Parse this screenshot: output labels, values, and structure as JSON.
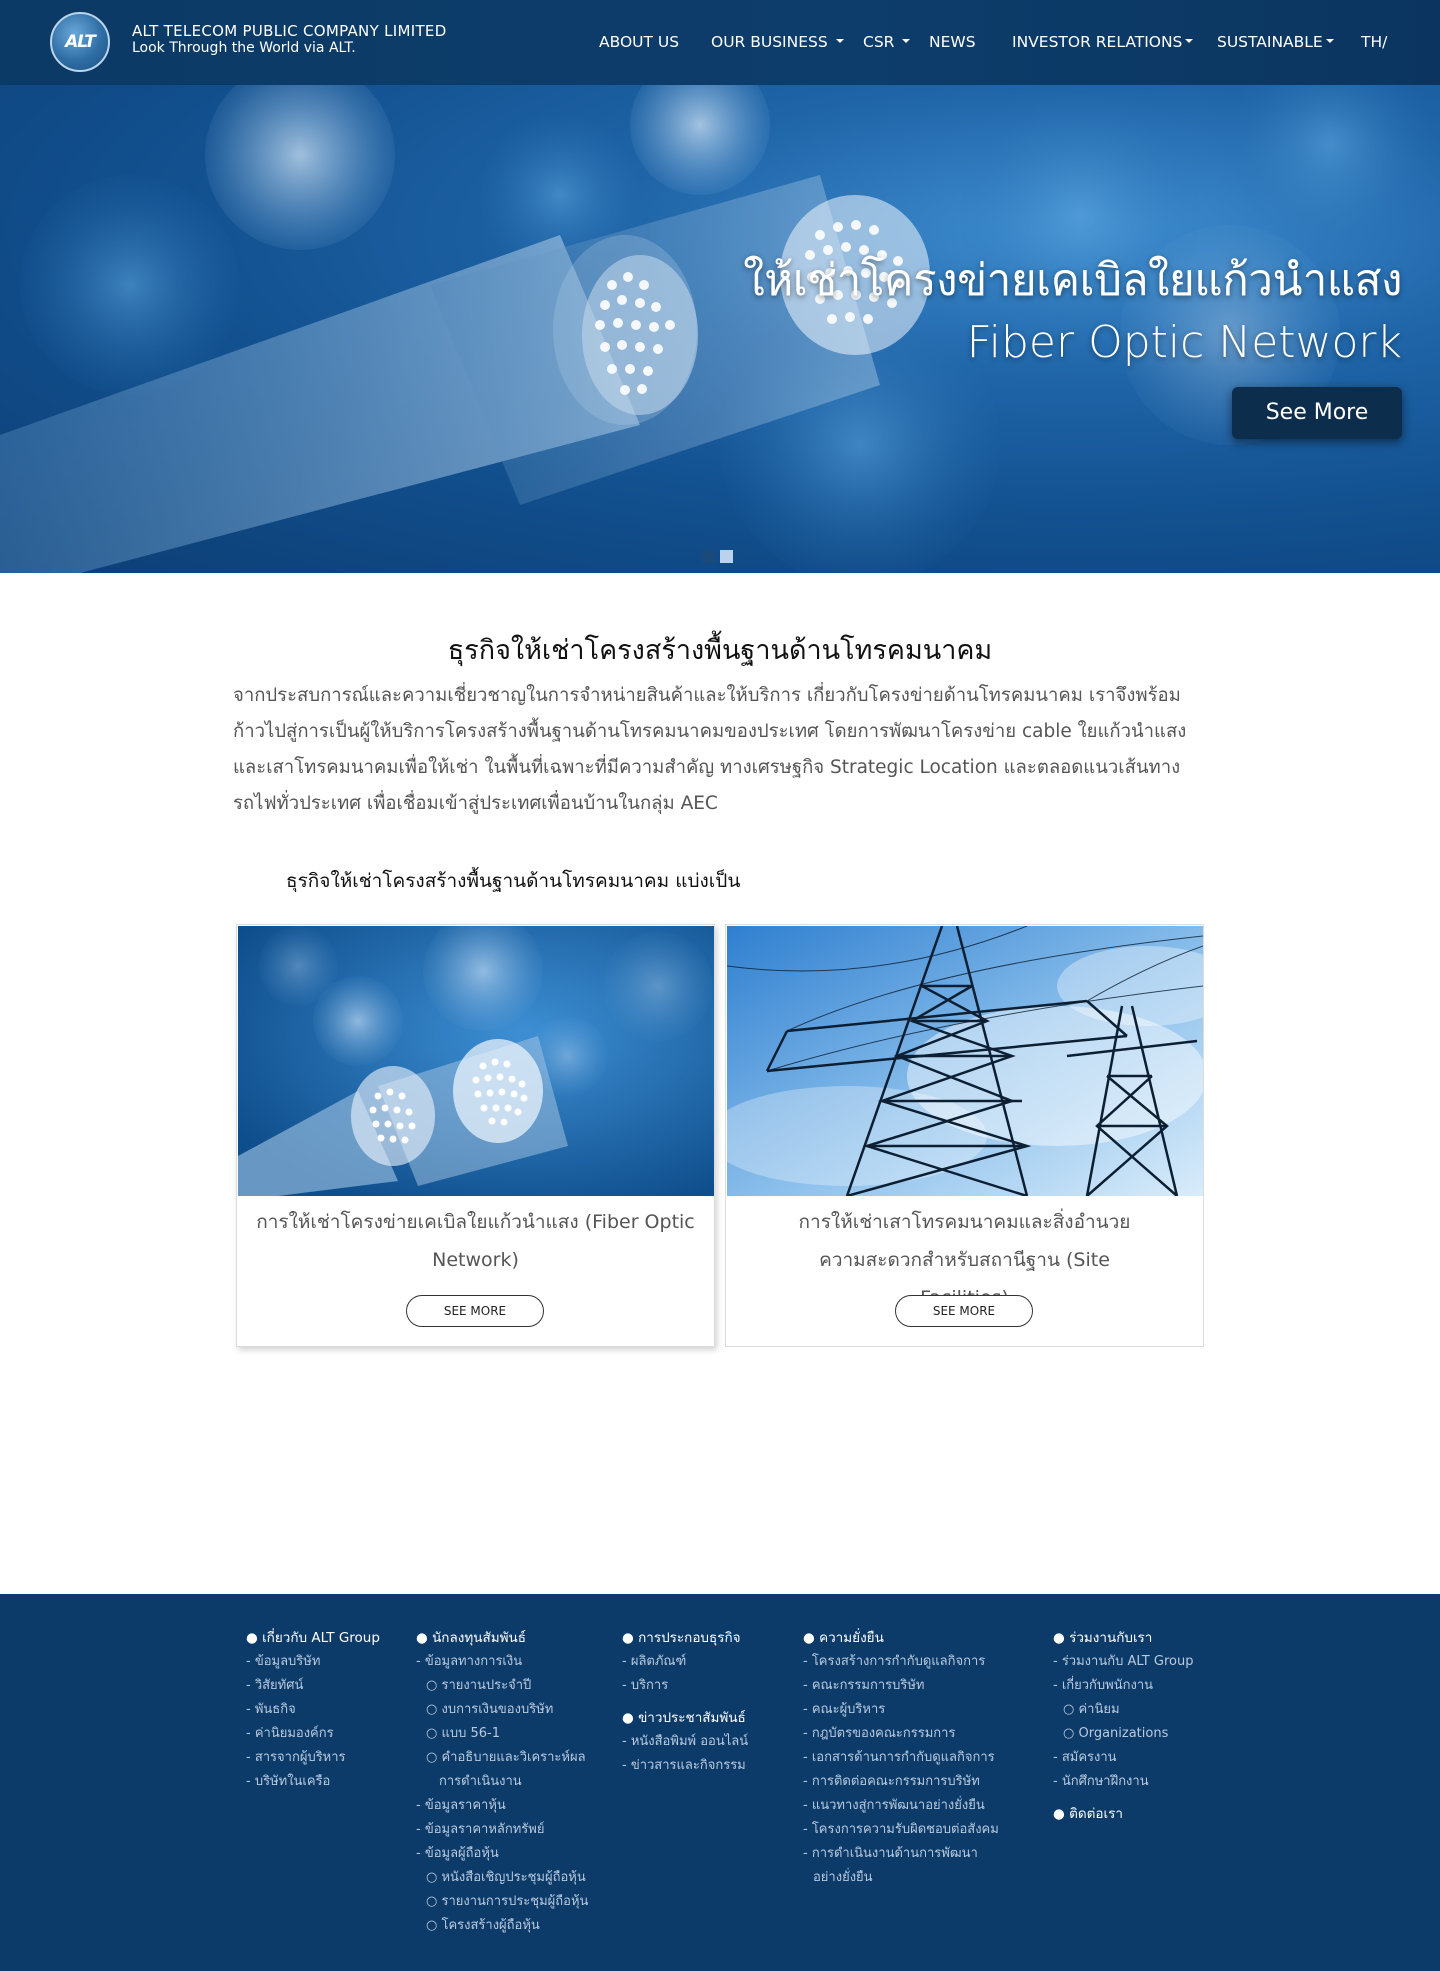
{
  "header": {
    "company_name": "ALT TELECOM PUBLIC COMPANY LIMITED",
    "tagline": "Look Through the World via ALT.",
    "logo_text": "ALT",
    "nav": [
      {
        "label": "ABOUT US",
        "dropdown": false
      },
      {
        "label": "OUR BUSINESS",
        "dropdown": true
      },
      {
        "label": "CSR",
        "dropdown": true
      },
      {
        "label": "NEWS",
        "dropdown": false
      },
      {
        "label": "INVESTOR RELATIONS",
        "dropdown": true
      },
      {
        "label": "SUSTAINABLE",
        "dropdown": true
      },
      {
        "label": "TH/",
        "dropdown": false
      }
    ]
  },
  "hero": {
    "title_th": "ให้เช่าโครงข่ายเคเบิลใยแก้วนำแสง",
    "title_en": "Fiber Optic Network",
    "button": "See More",
    "slides_total": 2,
    "active_slide": 1
  },
  "about": {
    "title": "ธุรกิจให้เช่าโครงสร้างพื้นฐานด้านโทรคมนาคม",
    "intro": "จากประสบการณ์และความเชี่ยวชาญในการจำหน่ายสินค้าและให้บริการ เกี่ยวกับโครงข่ายด้านโทรคมนาคม เราจึงพร้อมก้าวไปสู่การเป็นผู้ให้บริการโครงสร้างพื้นฐานด้านโทรคมนาคมของประเทศ โดยการพัฒนาโครงข่าย cable ใยแก้วนำแสง และเสาโทรคมนาคมเพื่อให้เช่า ในพื้นที่เฉพาะที่มีความสำคัญ ทางเศรษฐกิจ Strategic Location และตลอดแนวเส้นทางรถไฟทั่วประเทศ เพื่อเชื่อมเข้าสู่ประเทศเพื่อนบ้านในกลุ่ม AEC",
    "subhead": "ธุรกิจให้เช่าโครงสร้างพื้นฐานด้านโทรคมนาคม แบ่งเป็น"
  },
  "cards": [
    {
      "caption": "การให้เช่าโครงข่ายเคเบิลใยแก้วนำแสง (Fiber Optic Network)",
      "button": "SEE MORE",
      "image": "fiber-optic-cable"
    },
    {
      "caption": "การให้เช่าเสาโทรคมนาคมและสิ่งอำนวยความสะดวกสำหรับสถานีฐาน (Site Facilities)",
      "button": "SEE MORE",
      "image": "transmission-tower"
    }
  ],
  "footer": {
    "about": {
      "head": "● เกี่ยวกับ ALT Group",
      "items": [
        "- ข้อมูลบริษัท",
        "- วิสัยทัศน์",
        "- พันธกิจ",
        "- ค่านิยมองค์กร",
        "- สารจากผู้บริหาร",
        "- บริษัทในเครือ"
      ]
    },
    "investor": {
      "head": "● นักลงทุนสัมพันธ์",
      "items": [
        {
          "text": "- ข้อมูลทางการเงิน",
          "level": 1
        },
        {
          "text": "○ รายงานประจำปี",
          "level": 2
        },
        {
          "text": "○ งบการเงินของบริษัท",
          "level": 2
        },
        {
          "text": "○ แบบ 56-1",
          "level": 2
        },
        {
          "text": "○ คำอธิบายและวิเคราะห์ผล",
          "level": 2
        },
        {
          "text": "การดำเนินงาน",
          "level": 3
        },
        {
          "text": "- ข้อมูลราคาหุ้น",
          "level": 1
        },
        {
          "text": "- ข้อมูลราคาหลักทรัพย์",
          "level": 1
        },
        {
          "text": "- ข้อมูลผู้ถือหุ้น",
          "level": 1
        },
        {
          "text": "○ หนังสือเชิญประชุมผู้ถือหุ้น",
          "level": 2
        },
        {
          "text": "○ รายงานการประชุมผู้ถือหุ้น",
          "level": 2
        },
        {
          "text": "○ โครงสร้างผู้ถือหุ้น",
          "level": 2
        }
      ]
    },
    "business": {
      "head": "● การประกอบธุรกิจ",
      "items": [
        "- ผลิตภัณฑ์",
        "- บริการ"
      ],
      "head2": "● ข่าวประชาสัมพันธ์",
      "items2": [
        "- หนังสือพิมพ์ ออนไลน์",
        "- ข่าวสารและกิจกรรม"
      ]
    },
    "sustain": {
      "head": "● ความยั่งยืน",
      "items": [
        "- โครงสร้างการกำกับดูแลกิจการ",
        "- คณะกรรมการบริษัท",
        "- คณะผู้บริหาร",
        "- กฎบัตรของคณะกรรมการ",
        "- เอกสารด้านการกำกับดูแลกิจการ",
        "- การติดต่อคณะกรรมการบริษัท",
        "- แนวทางสู่การพัฒนาอย่างยั่งยืน",
        "- โครงการความรับผิดชอบต่อสังคม",
        "- การดำเนินงานด้านการพัฒนา",
        "อย่างยั่งยืน"
      ]
    },
    "join": {
      "head": "● ร่วมงานกับเรา",
      "items": [
        {
          "text": "- ร่วมงานกับ ALT Group",
          "level": 1
        },
        {
          "text": "- เกี่ยวกับพนักงาน",
          "level": 1
        },
        {
          "text": "○ ค่านิยม",
          "level": 2
        },
        {
          "text": "○ Organizations",
          "level": 2
        },
        {
          "text": "- สมัครงาน",
          "level": 1
        },
        {
          "text": "- นักศึกษาฝึกงาน",
          "level": 1
        }
      ],
      "contact": "● ติดต่อเรา"
    }
  }
}
